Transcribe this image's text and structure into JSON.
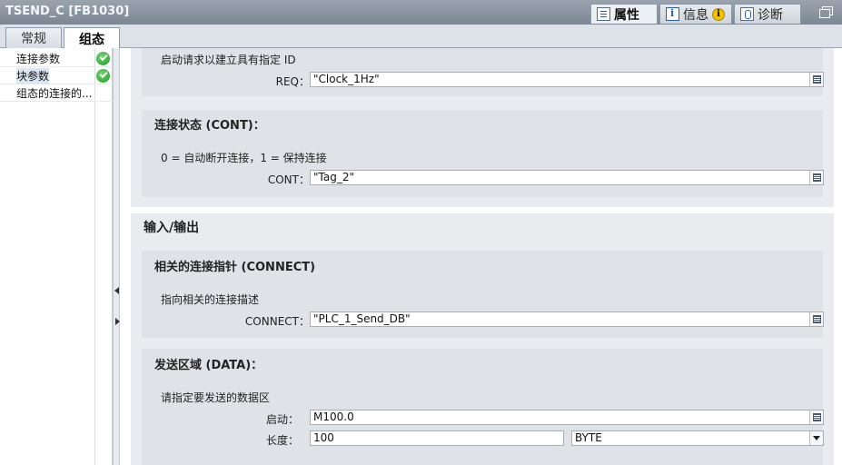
{
  "title_bar": {
    "title": "TSEND_C [FB1030]"
  },
  "right_tabs": [
    {
      "label": "属性",
      "icon": "properties-icon"
    },
    {
      "label": "信息",
      "icon": "info-icon"
    },
    {
      "label": "诊断",
      "icon": "diagnostics-icon"
    }
  ],
  "left_tabs": [
    {
      "label": "常规"
    },
    {
      "label": "组态"
    }
  ],
  "nav": {
    "items": [
      {
        "label": "连接参数",
        "status": "ok"
      },
      {
        "label": "块参数",
        "status": "ok",
        "selected": true
      },
      {
        "label": "组态的连接的..."
      }
    ]
  },
  "params": {
    "req_desc": "启动请求以建立具有指定 ID",
    "req_label": "REQ：",
    "req_value": "\"Clock_1Hz\"",
    "cont_title": "连接状态 (CONT)：",
    "cont_desc": "0 = 自动断开连接，1 = 保持连接",
    "cont_label": "CONT：",
    "cont_value": "\"Tag_2\"",
    "io_title": "输入/输出",
    "connect_title": "相关的连接指针 (CONNECT)",
    "connect_desc": "指向相关的连接描述",
    "connect_label": "CONNECT：",
    "connect_value": "\"PLC_1_Send_DB\"",
    "data_title": "发送区域 (DATA)：",
    "data_desc": "请指定要发送的数据区",
    "start_label": "启动：",
    "start_value": "M100.0",
    "length_label": "长度：",
    "length_value": "100",
    "type_value": "BYTE"
  }
}
